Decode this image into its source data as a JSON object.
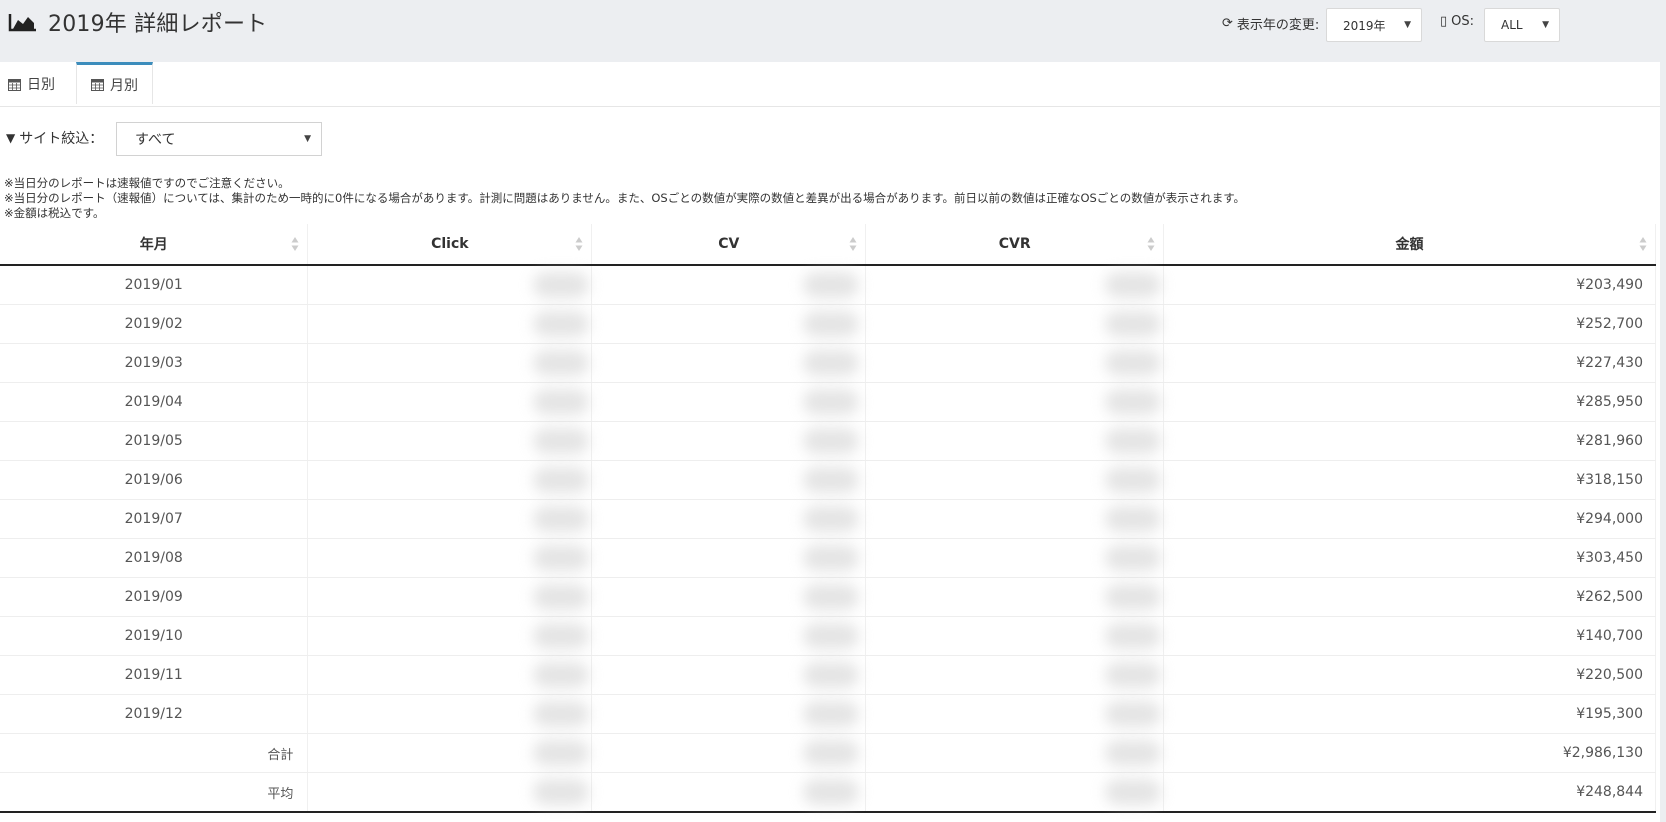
{
  "page": {
    "title": "2019年 詳細レポート",
    "title_icon": "area-chart-icon"
  },
  "controls": {
    "year_change_label": "表示年の変更:",
    "year_value": "2019年",
    "os_label": "OS:",
    "os_value": "ALL"
  },
  "tabs": [
    {
      "label": "日別",
      "icon": "calendar-icon",
      "active": false
    },
    {
      "label": "月別",
      "icon": "calendar-icon",
      "active": true
    }
  ],
  "filter": {
    "label": "サイト絞込：",
    "value": "すべて"
  },
  "notes": [
    "※当日分のレポートは速報値ですのでご注意ください。",
    "※当日分のレポート（速報値）については、集計のため一時的に0件になる場合があります。計測に問題はありません。また、OSごとの数値が実際の数値と差異が出る場合があります。前日以前の数値は正確なOSごとの数値が表示されます。",
    "※金額は税込です。"
  ],
  "table": {
    "columns": [
      "年月",
      "Click",
      "CV",
      "CVR",
      "金額"
    ],
    "rows": [
      {
        "month": "2019/01",
        "amount": "¥203,490"
      },
      {
        "month": "2019/02",
        "amount": "¥252,700"
      },
      {
        "month": "2019/03",
        "amount": "¥227,430"
      },
      {
        "month": "2019/04",
        "amount": "¥285,950"
      },
      {
        "month": "2019/05",
        "amount": "¥281,960"
      },
      {
        "month": "2019/06",
        "amount": "¥318,150"
      },
      {
        "month": "2019/07",
        "amount": "¥294,000"
      },
      {
        "month": "2019/08",
        "amount": "¥303,450"
      },
      {
        "month": "2019/09",
        "amount": "¥262,500"
      },
      {
        "month": "2019/10",
        "amount": "¥140,700"
      },
      {
        "month": "2019/11",
        "amount": "¥220,500"
      },
      {
        "month": "2019/12",
        "amount": "¥195,300"
      }
    ],
    "total": {
      "label": "合計",
      "amount": "¥2,986,130"
    },
    "average": {
      "label": "平均",
      "amount": "¥248,844"
    }
  },
  "colors": {
    "accent": "#3c8dbc",
    "background": "#eceef1"
  }
}
